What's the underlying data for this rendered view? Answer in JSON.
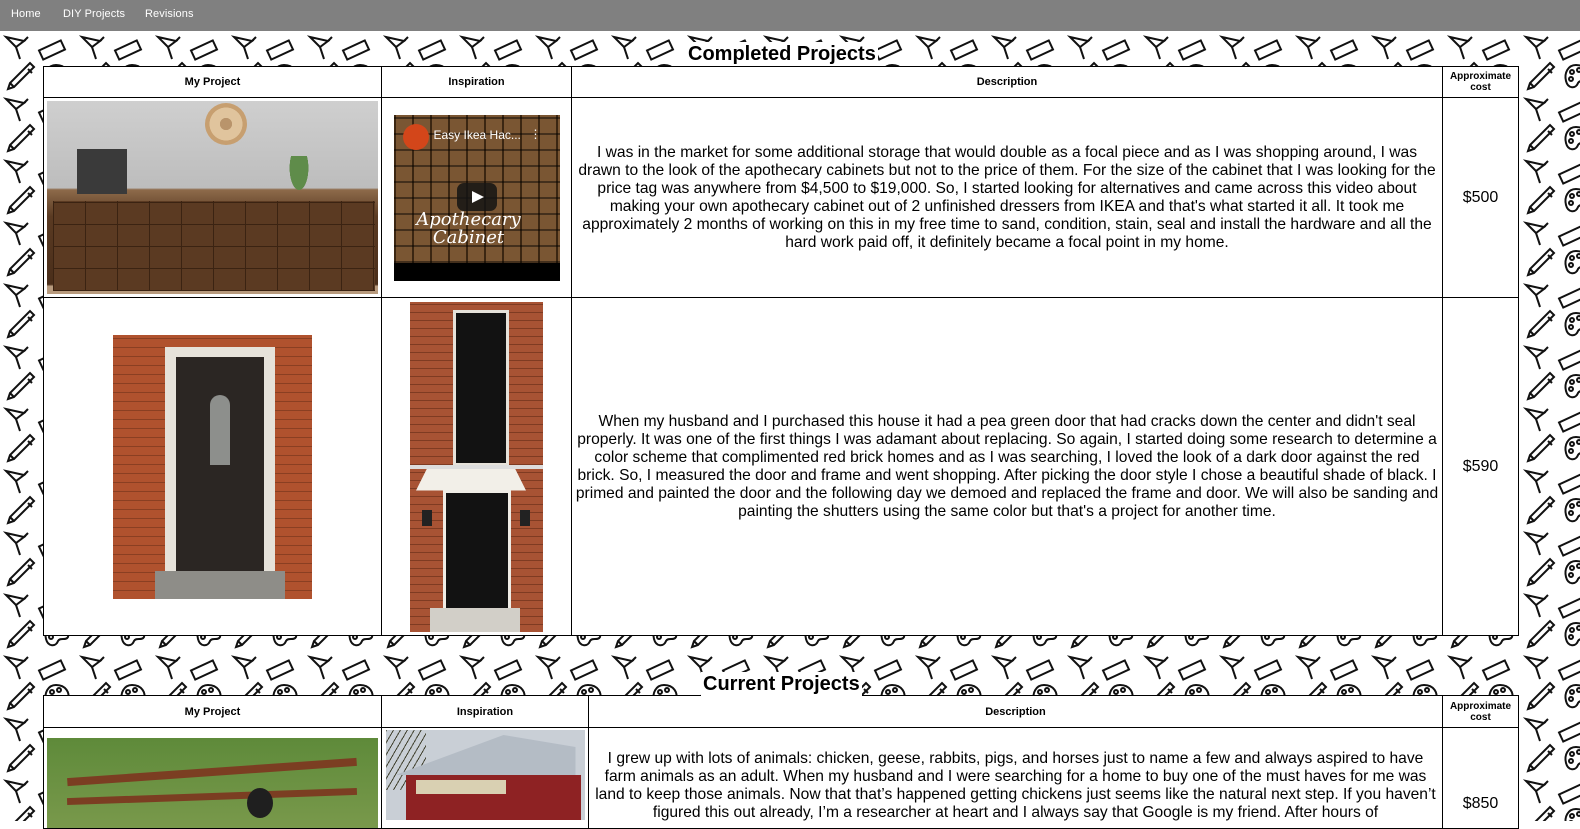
{
  "nav": {
    "items": [
      "Home",
      "DIY Projects",
      "Revisions"
    ]
  },
  "completed": {
    "title": "Completed Projects",
    "headers": {
      "project": "My Project",
      "inspiration": "Inspiration",
      "description": "Description",
      "cost": "Approximate cost"
    },
    "rows": [
      {
        "video_title": "Easy Ikea Hac...",
        "video_caption": "Apothecary Cabinet",
        "description": "I was in the market for some additional storage that would double as a focal piece and as I was shopping around, I was drawn to the look of the apothecary cabinets but not to the price of them. For the size of the cabinet that I was looking for the price tag was anywhere from $4,500 to $19,000. So, I started looking for alternatives and came across this video about making your own apothecary cabinet out of 2 unfinished dressers from IKEA and that's what started it all. It took me approximately 2 months of working on this in my free time to sand, condition, stain, seal and install the hardware and all the hard work paid off, it definitely became a focal point in my home.",
        "cost": "$500"
      },
      {
        "description": "When my husband and I purchased this house it had a pea green door that had cracks down the center and didn't seal properly. It was one of the first things I was adamant about replacing. So again, I started doing some research to determine a color scheme that complimented red brick homes and as I was searching, I loved the look of a dark door against the red brick. So, I measured the door and frame and went shopping. After picking the door style I chose a beautiful shade of black. I primed and painted the door and the following day we demoed and replaced the frame and door. We will also be sanding and painting the shutters using the same color but that's a project for another time.",
        "cost": "$590"
      }
    ]
  },
  "current": {
    "title": "Current Projects",
    "headers": {
      "project": "My Project",
      "inspiration": "Inspiration",
      "description": "Description",
      "cost": "Approximate cost"
    },
    "rows": [
      {
        "description": "I grew up with lots of animals: chicken, geese, rabbits, pigs, and horses just to name a few and always aspired to have farm animals as an adult. When my husband and I were searching for a home to buy one of the must haves for me was land to keep those animals. Now that that’s happened getting chickens just seems like the natural next step. If you haven’t figured this out already, I’m a researcher at heart and I always say that Google is my friend. After hours of",
        "cost": "$850"
      }
    ]
  },
  "icons": [
    "pencil-icon",
    "paintbrush-icon",
    "palette-icon",
    "ruler-icon",
    "push-pin-icon",
    "eraser-icon"
  ]
}
